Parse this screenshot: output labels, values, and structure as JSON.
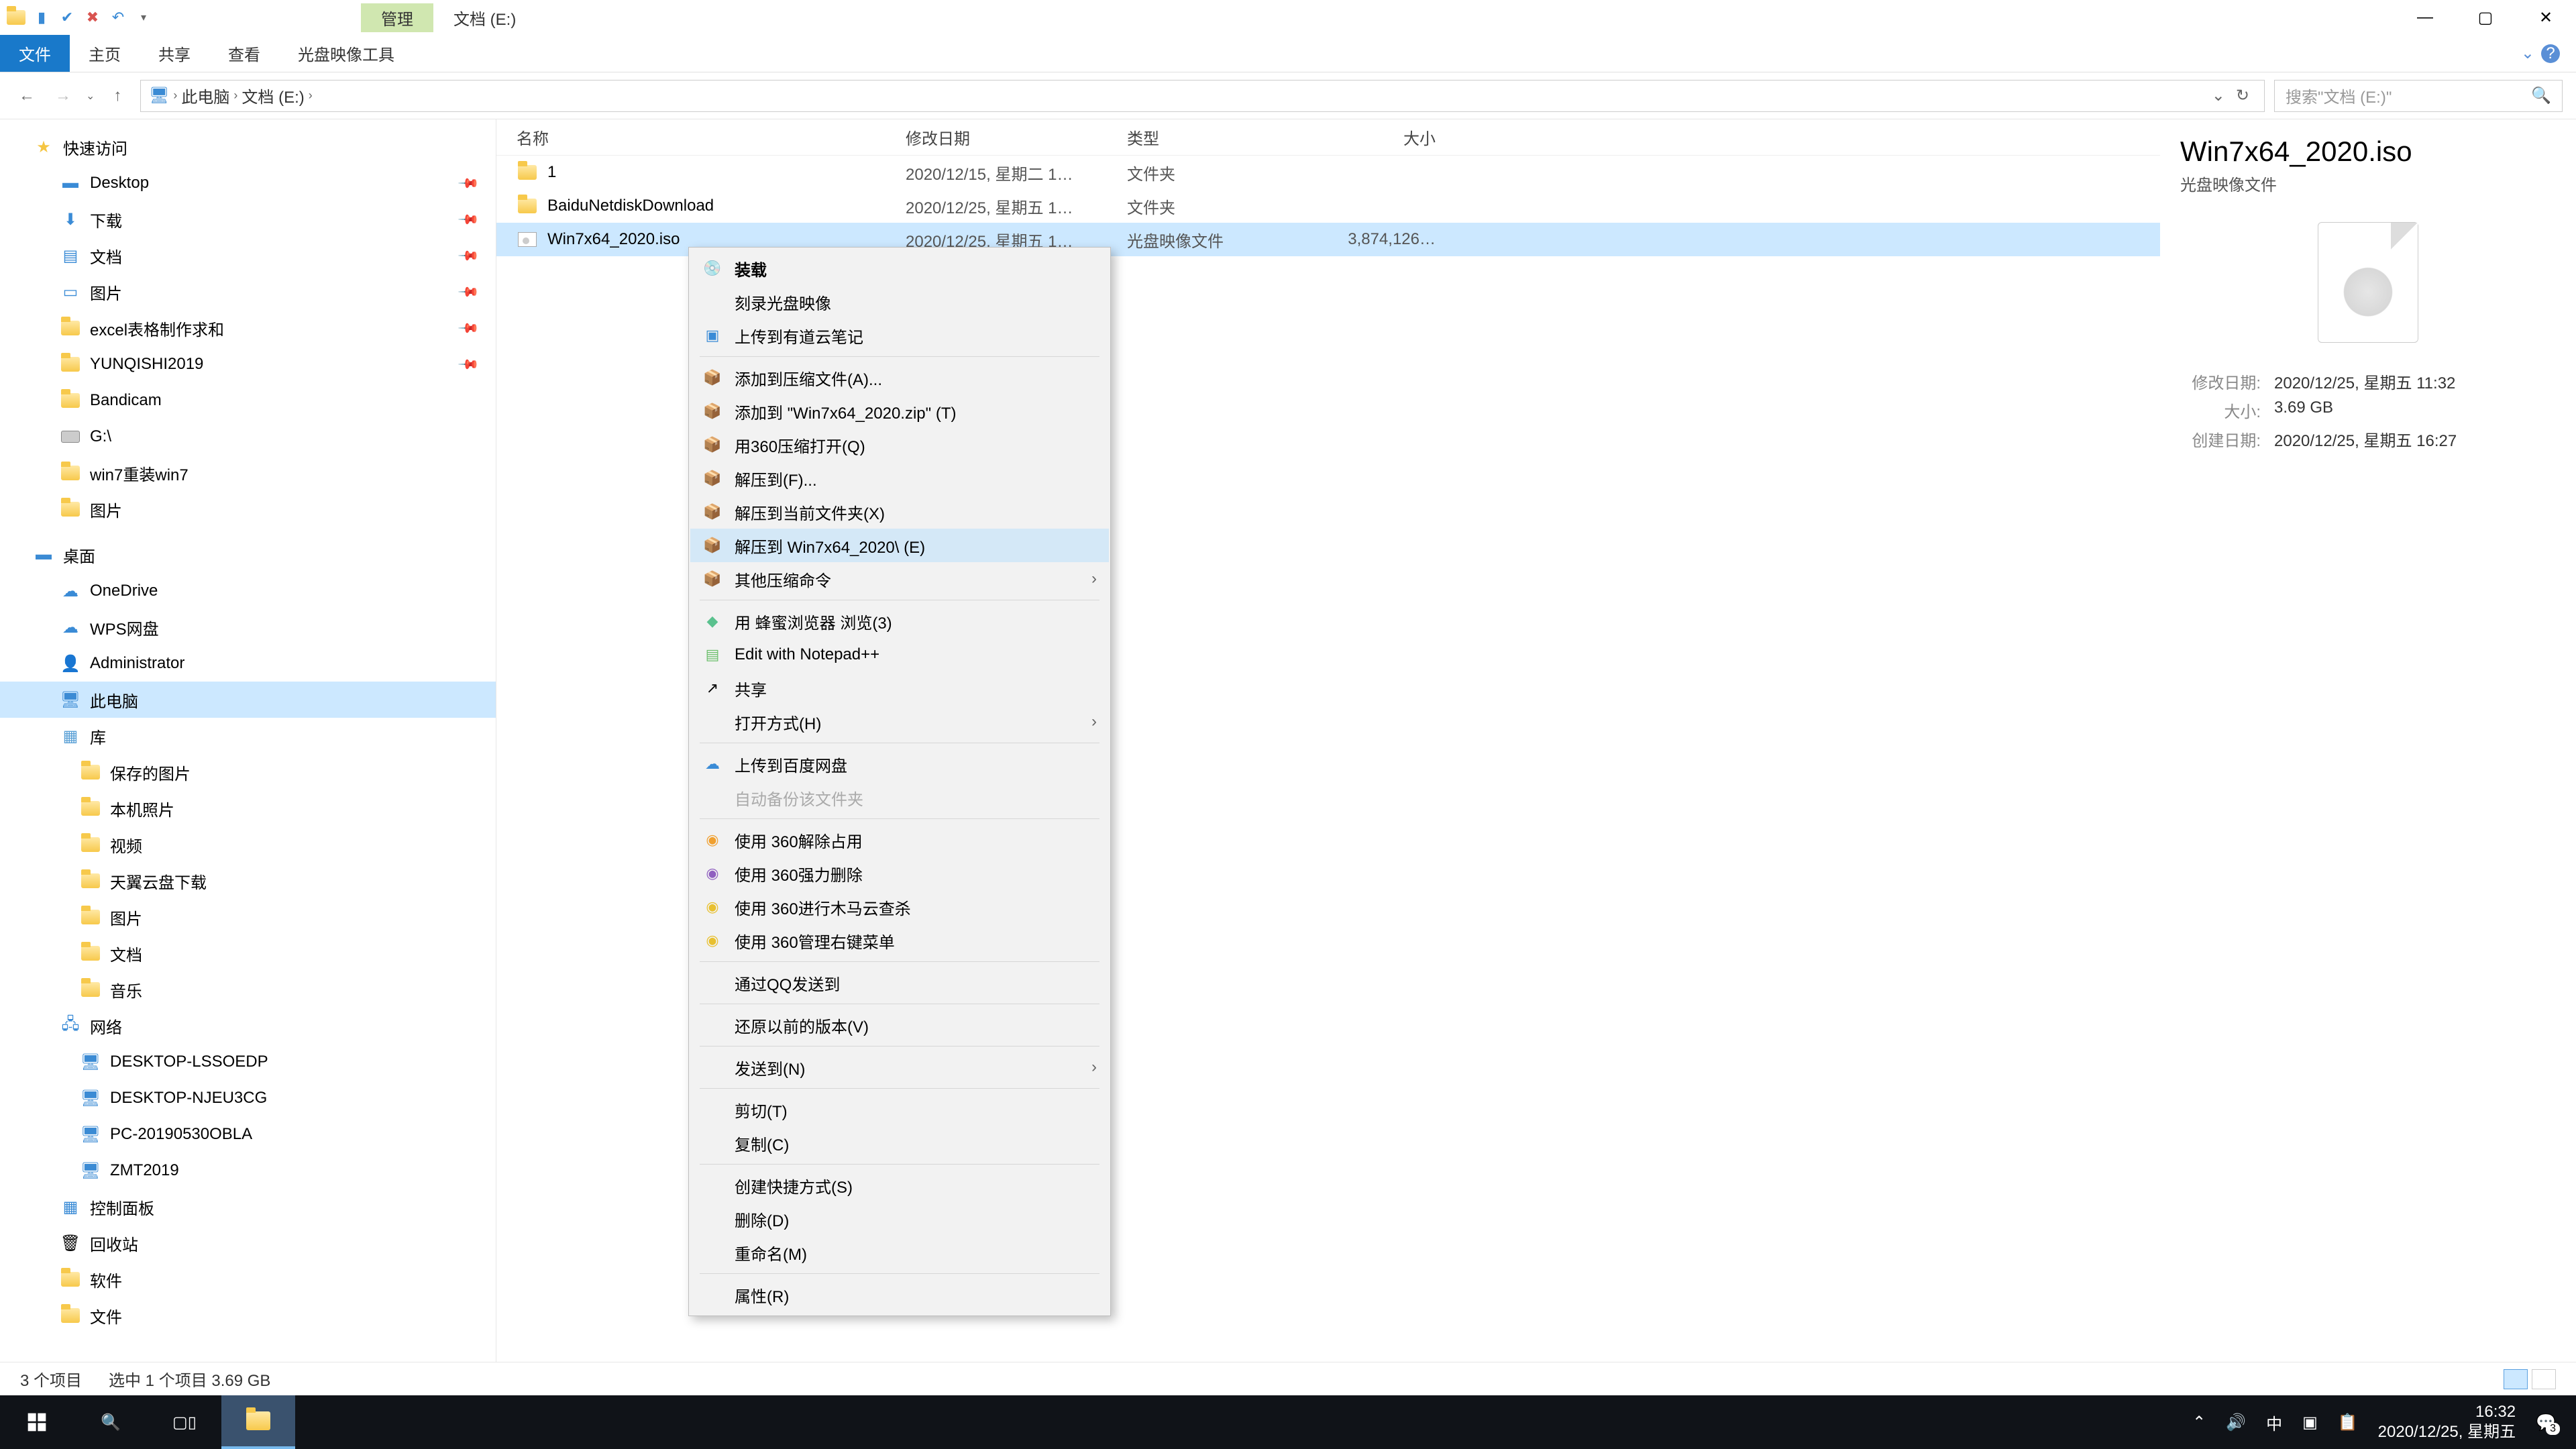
{
  "window": {
    "title": "文档 (E:)",
    "context_tab": "管理"
  },
  "ribbon": {
    "file": "文件",
    "home": "主页",
    "share": "共享",
    "view": "查看",
    "disc_tools": "光盘映像工具"
  },
  "nav": {
    "back": "←",
    "fwd": "→",
    "up": "↑"
  },
  "breadcrumb": {
    "root": "此电脑",
    "current": "文档 (E:)"
  },
  "search": {
    "placeholder": "搜索\"文档 (E:)\""
  },
  "tree": {
    "quick": "快速访问",
    "desktop": "Desktop",
    "downloads": "下载",
    "documents": "文档",
    "pictures": "图片",
    "excel": "excel表格制作求和",
    "yunqishi": "YUNQISHI2019",
    "bandicam": "Bandicam",
    "gdrive": "G:\\",
    "win7re": "win7重装win7",
    "pics2": "图片",
    "desktop_cn": "桌面",
    "onedrive": "OneDrive",
    "wps": "WPS网盘",
    "admin": "Administrator",
    "thispc": "此电脑",
    "libs": "库",
    "saved_pics": "保存的图片",
    "camera_roll": "本机照片",
    "videos": "视频",
    "tianyi": "天翼云盘下载",
    "pics3": "图片",
    "docs2": "文档",
    "music": "音乐",
    "network": "网络",
    "net1": "DESKTOP-LSSOEDP",
    "net2": "DESKTOP-NJEU3CG",
    "net3": "PC-20190530OBLA",
    "net4": "ZMT2019",
    "ctrl": "控制面板",
    "recycle": "回收站",
    "soft": "软件",
    "files": "文件"
  },
  "columns": {
    "name": "名称",
    "date": "修改日期",
    "type": "类型",
    "size": "大小"
  },
  "rows": [
    {
      "name": "1",
      "date": "2020/12/15, 星期二 1…",
      "type": "文件夹",
      "size": ""
    },
    {
      "name": "BaiduNetdiskDownload",
      "date": "2020/12/25, 星期五 1…",
      "type": "文件夹",
      "size": ""
    },
    {
      "name": "Win7x64_2020.iso",
      "date": "2020/12/25, 星期五 1…",
      "type": "光盘映像文件",
      "size": "3,874,126…"
    }
  ],
  "details": {
    "title": "Win7x64_2020.iso",
    "subtitle": "光盘映像文件",
    "modified_label": "修改日期:",
    "modified": "2020/12/25, 星期五 11:32",
    "size_label": "大小:",
    "size": "3.69 GB",
    "created_label": "创建日期:",
    "created": "2020/12/25, 星期五 16:27"
  },
  "status": {
    "count": "3 个项目",
    "selected": "选中 1 个项目  3.69 GB"
  },
  "ctx": {
    "mount": "装载",
    "burn": "刻录光盘映像",
    "youdao": "上传到有道云笔记",
    "add_archive": "添加到压缩文件(A)...",
    "add_zip": "添加到 \"Win7x64_2020.zip\" (T)",
    "open_360": "用360压缩打开(Q)",
    "extract_to": "解压到(F)...",
    "extract_here": "解压到当前文件夹(X)",
    "extract_named": "解压到 Win7x64_2020\\ (E)",
    "other_zip": "其他压缩命令",
    "honey": "用 蜂蜜浏览器 浏览(3)",
    "npp": "Edit with Notepad++",
    "share": "共享",
    "open_with": "打开方式(H)",
    "baidu": "上传到百度网盘",
    "autobak": "自动备份该文件夹",
    "occ360": "使用 360解除占用",
    "del360": "使用 360强力删除",
    "scan360": "使用 360进行木马云查杀",
    "mgr360": "使用 360管理右键菜单",
    "qqsend": "通过QQ发送到",
    "restore": "还原以前的版本(V)",
    "sendto": "发送到(N)",
    "cut": "剪切(T)",
    "copy": "复制(C)",
    "shortcut": "创建快捷方式(S)",
    "delete": "删除(D)",
    "rename": "重命名(M)",
    "props": "属性(R)"
  },
  "taskbar": {
    "time": "16:32",
    "ime": "中",
    "date": "2020/12/25, 星期五",
    "notif": "3"
  }
}
